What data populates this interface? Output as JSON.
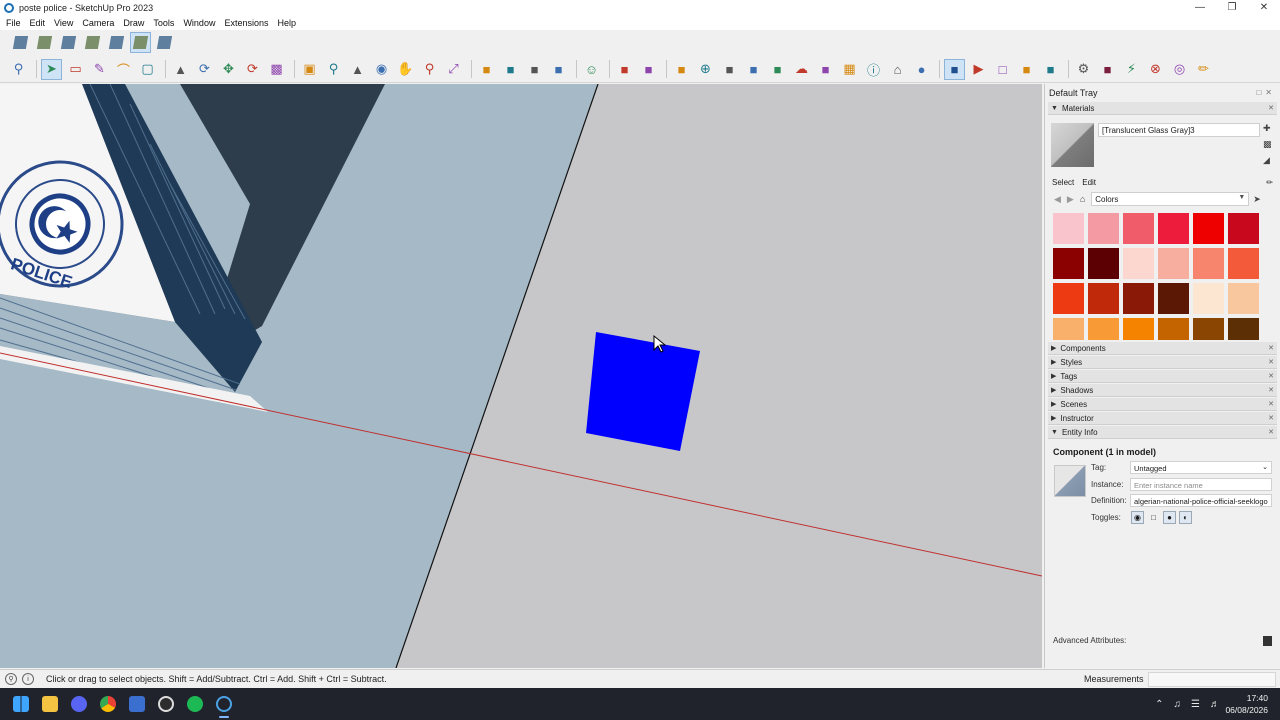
{
  "window": {
    "title": "poste police - SketchUp Pro 2023",
    "controls": [
      "minimize",
      "restore",
      "close"
    ]
  },
  "menu": [
    "File",
    "Edit",
    "View",
    "Camera",
    "Draw",
    "Tools",
    "Window",
    "Extensions",
    "Help"
  ],
  "toolbar_top": [
    "xray-icon",
    "back-edges-icon",
    "wireframe-icon",
    "hidden-line-icon",
    "shaded-icon",
    "shaded-textures-icon",
    "monochrome-icon"
  ],
  "toolbar_main": [
    "zoom-window-icon",
    "select-icon",
    "eraser-icon",
    "line-icon",
    "arc-icon",
    "shape-icon",
    "push-pull-icon",
    "follow-me-icon",
    "move-icon",
    "rotate-icon",
    "scale-icon",
    "offset-icon",
    "tape-measure-icon",
    "paint-bucket-icon",
    "orbit-icon",
    "pan-icon",
    "zoom-icon",
    "zoom-extents-icon",
    "section-plane-icon",
    "display-section-icon",
    "section-fill-icon",
    "section-cuts-icon",
    "camera-user-icon",
    "solid-tools-icon",
    "outer-shell-icon",
    "components-icon",
    "add-location-icon",
    "geo-icon",
    "sandbox-icon",
    "grid-icon",
    "cloud-icon",
    "extension-icon",
    "folder-icon",
    "info-icon",
    "warehouse-icon",
    "account-icon",
    "trimble-icon",
    "play-icon",
    "stop-icon",
    "camera-icon",
    "video-icon",
    "settings-icon",
    "ruby-icon",
    "bolt-icon",
    "close-circle-icon",
    "bulb-icon",
    "pencil-icon"
  ],
  "viewport": {
    "cursor": "arrow",
    "logo_text": "POLICE",
    "colors": {
      "background": "#c7c7ca",
      "facade": "#a4b8c6",
      "dark_wall": "#2b3a48",
      "selected_box": "#0000ff",
      "red_axis": "#c0302f",
      "edge": "#111111"
    }
  },
  "tray": {
    "title": "Default Tray",
    "materials": {
      "header": "Materials",
      "current_name": "[Translucent Glass Gray]3",
      "tabs": [
        "Select",
        "Edit"
      ],
      "library": "Colors",
      "swatches": [
        "#f9c4cb",
        "#f49aa3",
        "#f05c6a",
        "#ee1c3c",
        "#ee0000",
        "#c8081c",
        "#8b0000",
        "#5c0003",
        "#fbd7cf",
        "#f8ae9e",
        "#f7856e",
        "#f25a3a",
        "#ee3a12",
        "#c02a0a",
        "#8a1a07",
        "#5a1805",
        "#fde6d1",
        "#f9c79e",
        "#f9b06b",
        "#f89a36",
        "#f58300",
        "#c46400",
        "#8b4503",
        "#5c2f05"
      ]
    },
    "panels": [
      "Components",
      "Styles",
      "Tags",
      "Shadows",
      "Scenes",
      "Instructor",
      "Entity Info"
    ],
    "entity_info": {
      "title": "Component (1 in model)",
      "tag_label": "Tag:",
      "tag_value": "Untagged",
      "instance_label": "Instance:",
      "instance_placeholder": "Enter instance name",
      "definition_label": "Definition:",
      "definition_value": "algerian-national-police-official-seeklogo",
      "toggles_label": "Toggles:",
      "advanced_label": "Advanced Attributes:"
    }
  },
  "statusbar": {
    "text": "Click or drag to select objects. Shift = Add/Subtract. Ctrl = Add. Shift + Ctrl = Subtract.",
    "measurements_label": "Measurements"
  },
  "taskbar": {
    "apps": [
      "windows-start-icon",
      "file-explorer-icon",
      "discord-icon",
      "chrome-icon",
      "app-icon",
      "obs-icon",
      "spotify-icon",
      "sketchup-icon"
    ],
    "time": "17:40",
    "date": "06/08/2026"
  }
}
